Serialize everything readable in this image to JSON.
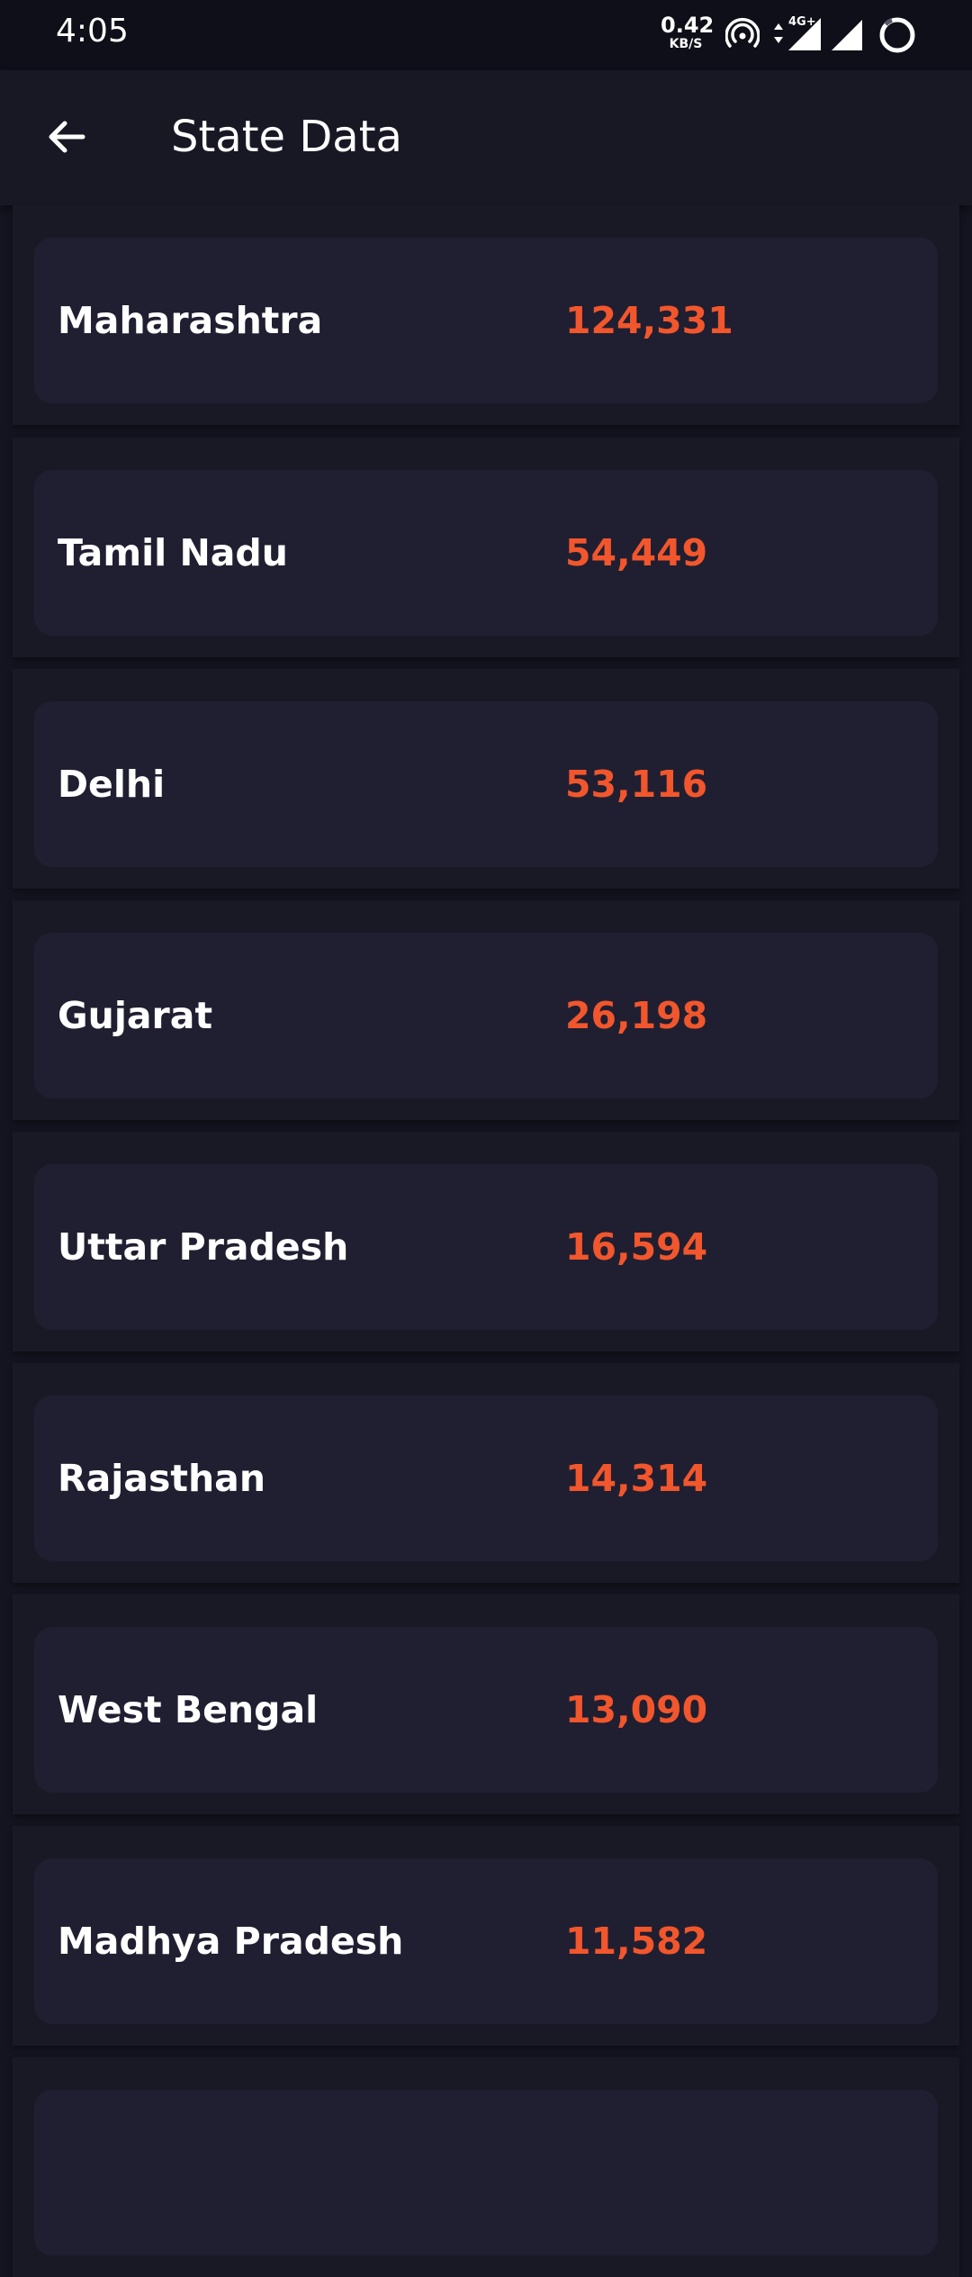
{
  "status_bar": {
    "time": "4:05",
    "net_speed_value": "0.42",
    "net_speed_unit": "KB/S",
    "network_type": "4G+",
    "icons": [
      "hotspot-icon",
      "data-arrows-icon",
      "signal-icon",
      "signal-icon",
      "battery-ring-icon"
    ]
  },
  "header": {
    "title": "State Data",
    "back_icon": "arrow-left-icon"
  },
  "colors": {
    "background": "#141420",
    "card": "#201f31",
    "accent": "#f2562c",
    "text": "#ffffff"
  },
  "states": [
    {
      "name": "Maharashtra",
      "count": "124,331"
    },
    {
      "name": "Tamil Nadu",
      "count": "54,449"
    },
    {
      "name": "Delhi",
      "count": "53,116"
    },
    {
      "name": "Gujarat",
      "count": "26,198"
    },
    {
      "name": "Uttar Pradesh",
      "count": "16,594"
    },
    {
      "name": "Rajasthan",
      "count": "14,314"
    },
    {
      "name": "West Bengal",
      "count": "13,090"
    },
    {
      "name": "Madhya Pradesh",
      "count": "11,582"
    }
  ]
}
